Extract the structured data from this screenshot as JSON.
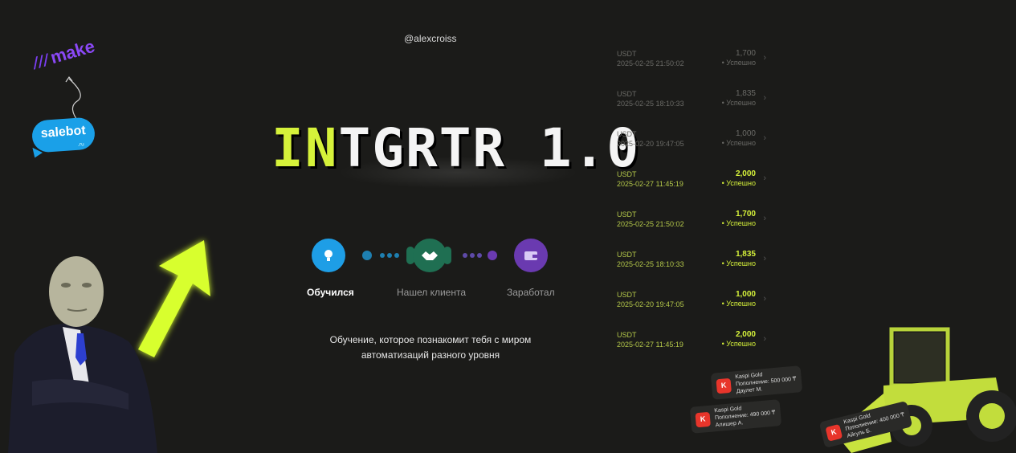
{
  "header": {
    "handle": "@alexcroiss"
  },
  "hero": {
    "title_accent": "IN",
    "title_rest": "TGRTR 1.0"
  },
  "logos": {
    "make": "make",
    "salebot": "salebot",
    "salebot_sub": ".ru"
  },
  "steps": [
    {
      "label": "Обучился",
      "icon": "lightbulb-icon",
      "color": "#1e9ee6"
    },
    {
      "label": "Нашел клиента",
      "icon": "handshake-icon",
      "color": "#1f6f52"
    },
    {
      "label": "Заработал",
      "icon": "wallet-icon",
      "color": "#6a3ab0"
    }
  ],
  "description": {
    "line1": "Обучение, которое познакомит тебя с миром",
    "line2": "автоматизаций разного уровня"
  },
  "transactions": [
    {
      "currency": "USDT",
      "date": "2025-02-25 21:50:02",
      "amount": "1,700",
      "status": "• Успешно"
    },
    {
      "currency": "USDT",
      "date": "2025-02-25 18:10:33",
      "amount": "1,835",
      "status": "• Успешно"
    },
    {
      "currency": "USDT",
      "date": "2025-02-20 19:47:05",
      "amount": "1,000",
      "status": "• Успешно"
    },
    {
      "currency": "USDT",
      "date": "2025-02-27 11:45:19",
      "amount": "2,000",
      "status": "• Успешно"
    },
    {
      "currency": "USDT",
      "date": "2025-02-25 21:50:02",
      "amount": "1,700",
      "status": "• Успешно"
    },
    {
      "currency": "USDT",
      "date": "2025-02-25 18:10:33",
      "amount": "1,835",
      "status": "• Успешно"
    },
    {
      "currency": "USDT",
      "date": "2025-02-20 19:47:05",
      "amount": "1,000",
      "status": "• Успешно"
    },
    {
      "currency": "USDT",
      "date": "2025-02-27 11:45:19",
      "amount": "2,000",
      "status": "• Успешно"
    }
  ],
  "notifications": [
    {
      "bank": "Kaspi Gold",
      "text": "Пополнение: 500 000 ₸",
      "name": "Даулет М."
    },
    {
      "bank": "Kaspi Gold",
      "text": "Пополнение: 490 000 ₸",
      "name": "Алишер А."
    },
    {
      "bank": "Kaspi Gold",
      "text": "Пополнение: 400 000 ₸",
      "name": "Айгуль Б."
    }
  ],
  "colors": {
    "accent": "#d6f23a",
    "background": "#1b1b19"
  }
}
